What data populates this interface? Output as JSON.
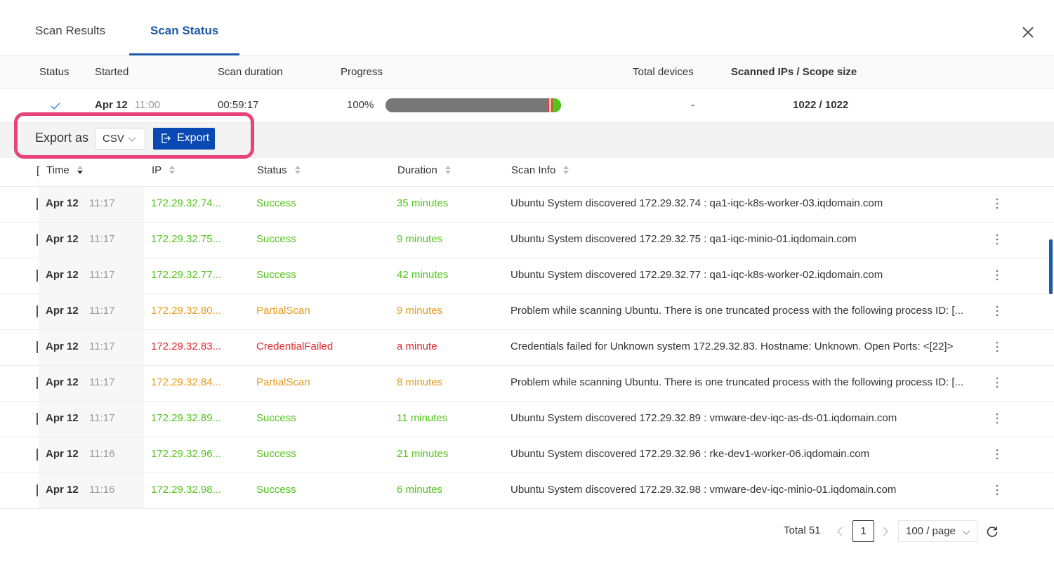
{
  "tabs": [
    {
      "label": "Scan Results",
      "active": false
    },
    {
      "label": "Scan Status",
      "active": true
    }
  ],
  "summary": {
    "headers": {
      "status": "Status",
      "started": "Started",
      "duration": "Scan duration",
      "progress": "Progress",
      "total_devices": "Total devices",
      "scanned": "Scanned IPs / Scope size"
    },
    "row": {
      "status_icon": "check-icon",
      "started_date": "Apr 12",
      "started_time": "11:00",
      "duration": "00:59:17",
      "progress_pct": "100%",
      "progress_value": 1.0,
      "total_devices": "-",
      "scanned": "1022 / 1022"
    }
  },
  "export": {
    "label": "Export as",
    "format": "CSV",
    "button": "Export"
  },
  "table": {
    "columns": {
      "time": "Time",
      "ip": "IP",
      "status": "Status",
      "duration": "Duration",
      "scan_info": "Scan Info"
    },
    "rows": [
      {
        "date": "Apr 12",
        "time": "11:17",
        "ip": "172.29.32.74...",
        "status": "Success",
        "duration": "35 minutes",
        "info": "Ubuntu System discovered 172.29.32.74 : qa1-iqc-k8s-worker-03.iqdomain.com"
      },
      {
        "date": "Apr 12",
        "time": "11:17",
        "ip": "172.29.32.75...",
        "status": "Success",
        "duration": "9 minutes",
        "info": "Ubuntu System discovered 172.29.32.75 : qa1-iqc-minio-01.iqdomain.com"
      },
      {
        "date": "Apr 12",
        "time": "11:17",
        "ip": "172.29.32.77...",
        "status": "Success",
        "duration": "42 minutes",
        "info": "Ubuntu System discovered 172.29.32.77 : qa1-iqc-k8s-worker-02.iqdomain.com"
      },
      {
        "date": "Apr 12",
        "time": "11:17",
        "ip": "172.29.32.80...",
        "status": "PartialScan",
        "duration": "9 minutes",
        "info": "Problem while scanning Ubuntu. There is one truncated process with the following process ID: [..."
      },
      {
        "date": "Apr 12",
        "time": "11:17",
        "ip": "172.29.32.83...",
        "status": "CredentialFailed",
        "duration": "a minute",
        "info": "Credentials failed for Unknown system 172.29.32.83. Hostname: Unknown. Open Ports: <[22]>"
      },
      {
        "date": "Apr 12",
        "time": "11:17",
        "ip": "172.29.32.84...",
        "status": "PartialScan",
        "duration": "8 minutes",
        "info": "Problem while scanning Ubuntu. There is one truncated process with the following process ID: [..."
      },
      {
        "date": "Apr 12",
        "time": "11:17",
        "ip": "172.29.32.89...",
        "status": "Success",
        "duration": "11 minutes",
        "info": "Ubuntu System discovered 172.29.32.89 : vmware-dev-iqc-as-ds-01.iqdomain.com"
      },
      {
        "date": "Apr 12",
        "time": "11:16",
        "ip": "172.29.32.96...",
        "status": "Success",
        "duration": "21 minutes",
        "info": "Ubuntu System discovered 172.29.32.96 : rke-dev1-worker-06.iqdomain.com"
      },
      {
        "date": "Apr 12",
        "time": "11:16",
        "ip": "172.29.32.98...",
        "status": "Success",
        "duration": "6 minutes",
        "info": "Ubuntu System discovered 172.29.32.98 : vmware-dev-iqc-minio-01.iqdomain.com"
      }
    ]
  },
  "pagination": {
    "total": "Total 51",
    "current_page": "1",
    "page_size": "100 / page"
  },
  "colors": {
    "accent": "#1a5aa8",
    "button": "#0a48b3",
    "success": "#52c41a",
    "partial": "#e89a1a",
    "failed": "#e0282e",
    "highlight": "#e8437a"
  }
}
